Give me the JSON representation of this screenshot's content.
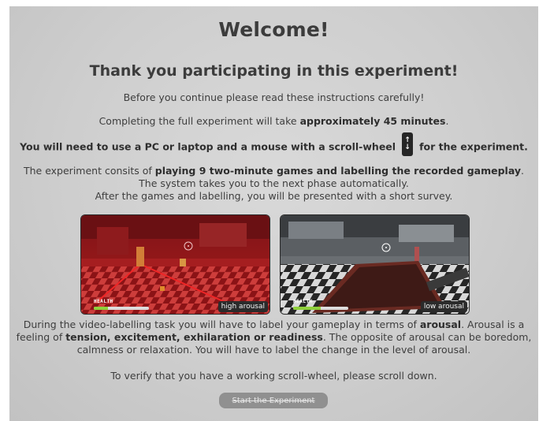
{
  "header": {
    "title": "Welcome!",
    "subtitle": "Thank you participating in this experiment!"
  },
  "instructions": {
    "before": "Before you continue please read these instructions carefully!",
    "complete_prefix": "Completing the full experiment will take ",
    "complete_bold": "approximately 45 minutes",
    "complete_suffix": ".",
    "pc_prefix": "You will need to use a PC or laptop and a mouse with a scroll-wheel",
    "pc_suffix": "for the experiment.",
    "consists_prefix": "The experiment consits of ",
    "consists_bold": "playing 9 two-minute games and labelling the recorded gameplay",
    "consists_suffix": ".",
    "system": "The system takes you to the next phase automatically.",
    "after": "After the games and labelling, you will be presented with a short survey."
  },
  "examples": {
    "high": {
      "label": "high arousal",
      "health_text": "HEALTH",
      "health_fraction": 0.25
    },
    "low": {
      "label": "low arousal",
      "health_text": "HEALTH",
      "health_fraction": 0.5
    }
  },
  "arousal": {
    "line1_prefix": "During the video-labelling task you will have to label your gameplay in terms of ",
    "line1_bold": "arousal",
    "line1_suffix": ". Arousal is a",
    "line2_prefix": "feeling of ",
    "line2_bold": "tension, excitement, exhilaration or readiness",
    "line2_suffix": ". The opposite of arousal can be boredom,",
    "line3": "calmness or relaxation. You will have to label the change in the level of arousal."
  },
  "verify": "To verify that you have a working scroll-wheel, please scroll down.",
  "start_button": "Start the Experiment",
  "icons": {
    "scroll": "scroll-wheel-icon",
    "crosshair": "crosshair-icon"
  },
  "colors": {
    "high_tint": "#c0181a",
    "health_fill": "#8fd13c",
    "button_bg": "#909090"
  }
}
